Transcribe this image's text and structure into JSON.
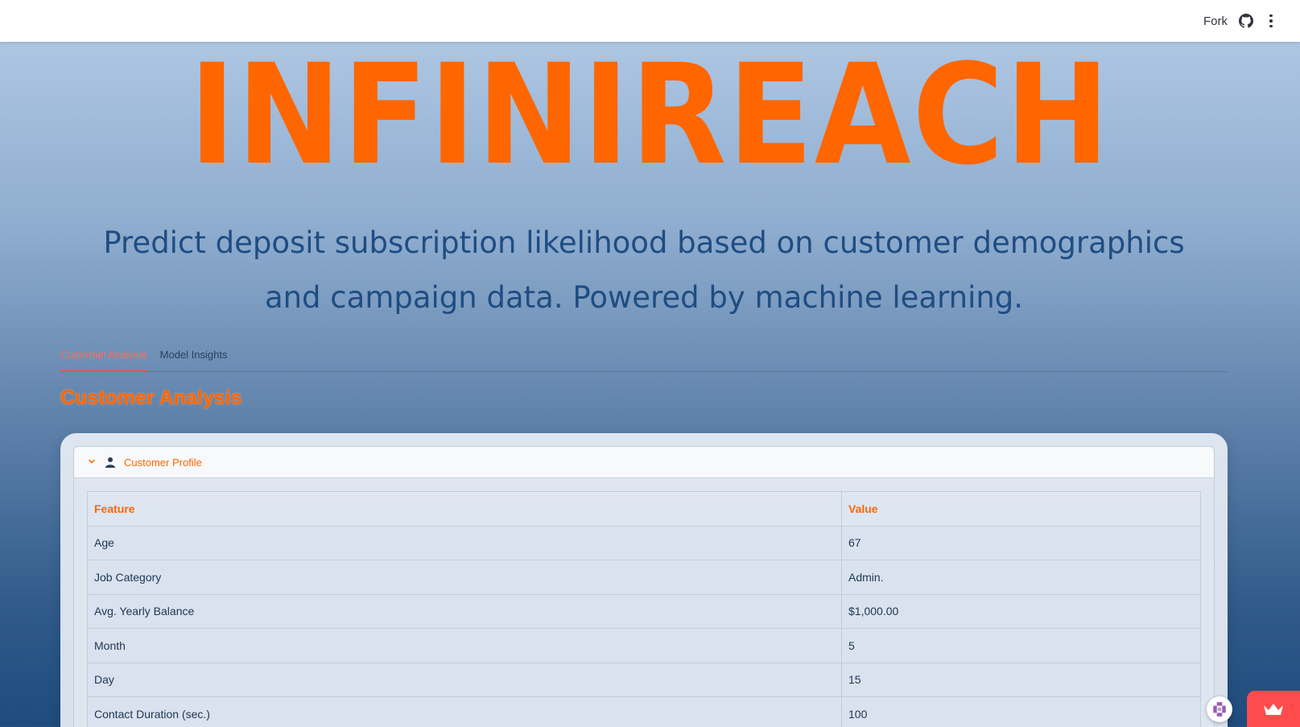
{
  "header": {
    "fork_label": "Fork",
    "icons": [
      "github-icon",
      "more-vertical-icon"
    ]
  },
  "hero": {
    "title": "INFINIREACH",
    "subtitle": "Predict deposit subscription likelihood based on customer demographics and campaign data. Powered by machine learning."
  },
  "tabs": [
    {
      "label": "Customer Analysis",
      "active": true
    },
    {
      "label": "Model Insights",
      "active": false
    }
  ],
  "section": {
    "title": "Customer Analysis"
  },
  "expander": {
    "label": "Customer Profile",
    "expanded": true,
    "icon": "person-icon"
  },
  "profile_table": {
    "columns": [
      "Feature",
      "Value"
    ],
    "rows": [
      {
        "feature": "Age",
        "value": "67"
      },
      {
        "feature": "Job Category",
        "value": "Admin."
      },
      {
        "feature": "Avg. Yearly Balance",
        "value": "$1,000.00"
      },
      {
        "feature": "Month",
        "value": "5"
      },
      {
        "feature": "Day",
        "value": "15"
      },
      {
        "feature": "Contact Duration (sec.)",
        "value": "100"
      }
    ]
  },
  "colors": {
    "accent": "#ff6600",
    "tab_active": "#ff4b4b",
    "subtitle": "#1e4d83"
  }
}
